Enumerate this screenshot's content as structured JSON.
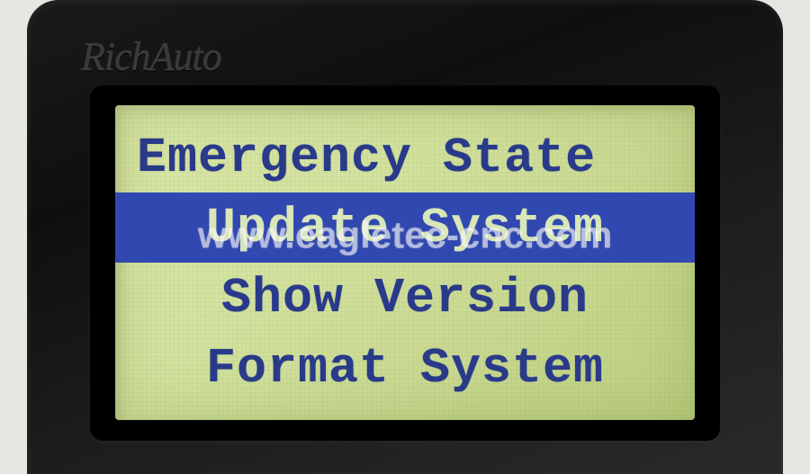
{
  "device": {
    "brand": "RichAuto"
  },
  "watermark": "www.eagletec-cnc.com",
  "menu": {
    "title": "Emergency State",
    "items": [
      {
        "label": "Emergency State",
        "selected": false,
        "align": "left"
      },
      {
        "label": "Update System",
        "selected": true,
        "align": "center"
      },
      {
        "label": "Show Version",
        "selected": false,
        "align": "center"
      },
      {
        "label": "Format System",
        "selected": false,
        "align": "center"
      }
    ]
  }
}
